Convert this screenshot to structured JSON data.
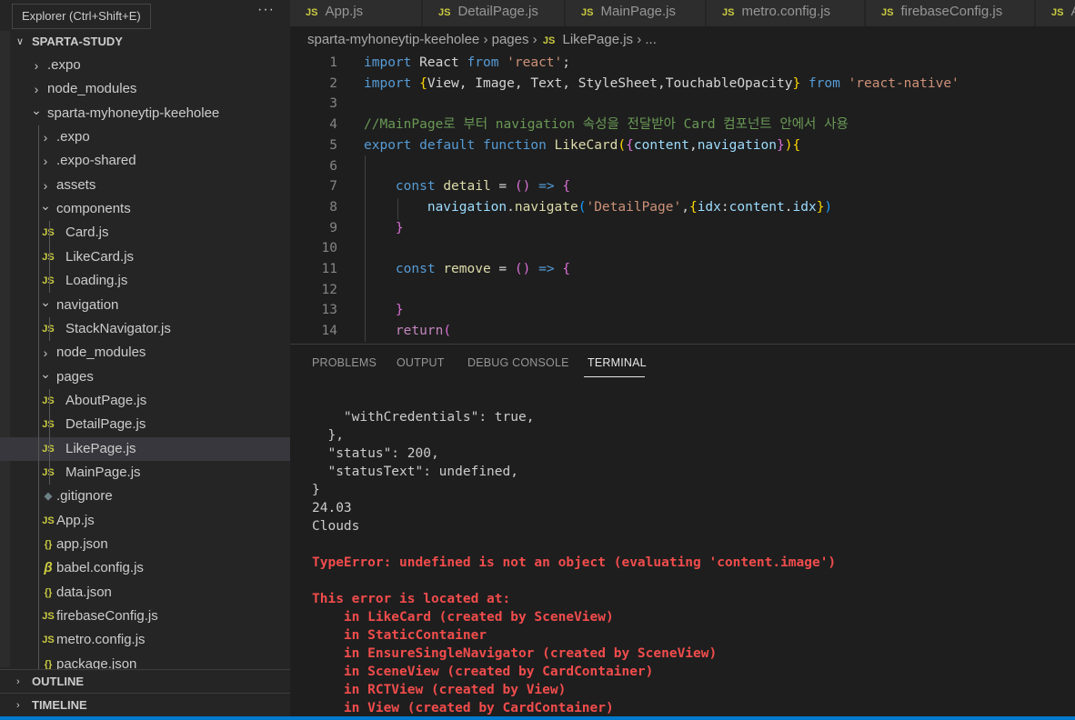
{
  "sidebar": {
    "tooltip": "Explorer (Ctrl+Shift+E)",
    "more_actions": "···",
    "root": "SPARTA-STUDY",
    "tree": [
      {
        "label": ".expo",
        "depth": 1,
        "kind": "folder",
        "expanded": false
      },
      {
        "label": "node_modules",
        "depth": 1,
        "kind": "folder",
        "expanded": false
      },
      {
        "label": "sparta-myhoneytip-keeholee",
        "depth": 1,
        "kind": "folder",
        "expanded": true
      },
      {
        "label": ".expo",
        "depth": 2,
        "kind": "folder",
        "expanded": false
      },
      {
        "label": ".expo-shared",
        "depth": 2,
        "kind": "folder",
        "expanded": false
      },
      {
        "label": "assets",
        "depth": 2,
        "kind": "folder",
        "expanded": false
      },
      {
        "label": "components",
        "depth": 2,
        "kind": "folder",
        "expanded": true
      },
      {
        "label": "Card.js",
        "depth": 3,
        "kind": "js"
      },
      {
        "label": "LikeCard.js",
        "depth": 3,
        "kind": "js"
      },
      {
        "label": "Loading.js",
        "depth": 3,
        "kind": "js"
      },
      {
        "label": "navigation",
        "depth": 2,
        "kind": "folder",
        "expanded": true
      },
      {
        "label": "StackNavigator.js",
        "depth": 3,
        "kind": "js"
      },
      {
        "label": "node_modules",
        "depth": 2,
        "kind": "folder",
        "expanded": false
      },
      {
        "label": "pages",
        "depth": 2,
        "kind": "folder",
        "expanded": true
      },
      {
        "label": "AboutPage.js",
        "depth": 3,
        "kind": "js"
      },
      {
        "label": "DetailPage.js",
        "depth": 3,
        "kind": "js"
      },
      {
        "label": "LikePage.js",
        "depth": 3,
        "kind": "js",
        "selected": true
      },
      {
        "label": "MainPage.js",
        "depth": 3,
        "kind": "js"
      },
      {
        "label": ".gitignore",
        "depth": 2,
        "kind": "git"
      },
      {
        "label": "App.js",
        "depth": 2,
        "kind": "js"
      },
      {
        "label": "app.json",
        "depth": 2,
        "kind": "json"
      },
      {
        "label": "babel.config.js",
        "depth": 2,
        "kind": "babel"
      },
      {
        "label": "data.json",
        "depth": 2,
        "kind": "json"
      },
      {
        "label": "firebaseConfig.js",
        "depth": 2,
        "kind": "js"
      },
      {
        "label": "metro.config.js",
        "depth": 2,
        "kind": "js"
      },
      {
        "label": "package.json",
        "depth": 2,
        "kind": "json"
      }
    ],
    "outline": "OUTLINE",
    "timeline": "TIMELINE"
  },
  "icons": {
    "js": "JS",
    "json": "{}",
    "git": "◆",
    "babel": "β",
    "chev_right": "›",
    "chev_down": "⌄"
  },
  "colors": {
    "js_icon": "#cbcb41",
    "json_icon": "#cbcb41",
    "git_icon": "#6d8086",
    "babel_icon": "#cbcb41",
    "error": "#f14c4c"
  },
  "editor": {
    "tabs": [
      "App.js",
      "DetailPage.js",
      "MainPage.js",
      "metro.config.js",
      "firebaseConfig.js",
      "A"
    ],
    "breadcrumb": {
      "project": "sparta-myhoneytip-keeholee",
      "sep": "›",
      "folder": "pages",
      "file": "LikePage.js",
      "more": "..."
    },
    "lines": [
      {
        "n": "1",
        "tokens": [
          [
            "kw",
            "import"
          ],
          [
            "plain",
            " React "
          ],
          [
            "kw",
            "from"
          ],
          [
            "plain",
            " "
          ],
          [
            "str",
            "'react'"
          ],
          [
            "plain",
            ";"
          ]
        ]
      },
      {
        "n": "2",
        "tokens": [
          [
            "kw",
            "import"
          ],
          [
            "plain",
            " "
          ],
          [
            "br1",
            "{"
          ],
          [
            "plain",
            "View, Image, Text, StyleSheet,TouchableOpacity"
          ],
          [
            "br1",
            "}"
          ],
          [
            "plain",
            " "
          ],
          [
            "kw",
            "from"
          ],
          [
            "plain",
            " "
          ],
          [
            "str",
            "'react-native'"
          ]
        ]
      },
      {
        "n": "3",
        "tokens": []
      },
      {
        "n": "4",
        "tokens": [
          [
            "cm",
            "//MainPage로 부터 navigation 속성을 전달받아 Card 컴포넌트 안에서 사용"
          ]
        ]
      },
      {
        "n": "5",
        "tokens": [
          [
            "kw",
            "export"
          ],
          [
            "plain",
            " "
          ],
          [
            "kw",
            "default"
          ],
          [
            "plain",
            " "
          ],
          [
            "kw",
            "function"
          ],
          [
            "plain",
            " "
          ],
          [
            "fn",
            "LikeCard"
          ],
          [
            "br1",
            "("
          ],
          [
            "br2",
            "{"
          ],
          [
            "var",
            "content"
          ],
          [
            "plain",
            ","
          ],
          [
            "var",
            "navigation"
          ],
          [
            "br2",
            "}"
          ],
          [
            "br1",
            ")"
          ],
          [
            "br1",
            "{"
          ]
        ]
      },
      {
        "n": "6",
        "tokens": []
      },
      {
        "n": "7",
        "tokens": [
          [
            "plain",
            "    "
          ],
          [
            "kw",
            "const"
          ],
          [
            "plain",
            " "
          ],
          [
            "fn",
            "detail"
          ],
          [
            "plain",
            " = "
          ],
          [
            "br2",
            "()"
          ],
          [
            "plain",
            " "
          ],
          [
            "kw",
            "=>"
          ],
          [
            "plain",
            " "
          ],
          [
            "br2",
            "{"
          ]
        ]
      },
      {
        "n": "8",
        "tokens": [
          [
            "plain",
            "        "
          ],
          [
            "var",
            "navigation"
          ],
          [
            "plain",
            "."
          ],
          [
            "fn",
            "navigate"
          ],
          [
            "br3",
            "("
          ],
          [
            "str",
            "'DetailPage'"
          ],
          [
            "plain",
            ","
          ],
          [
            "br1",
            "{"
          ],
          [
            "var",
            "idx"
          ],
          [
            "plain",
            ":"
          ],
          [
            "var",
            "content"
          ],
          [
            "plain",
            "."
          ],
          [
            "var",
            "idx"
          ],
          [
            "br1",
            "}"
          ],
          [
            "br3",
            ")"
          ]
        ]
      },
      {
        "n": "9",
        "tokens": [
          [
            "plain",
            "    "
          ],
          [
            "br2",
            "}"
          ]
        ]
      },
      {
        "n": "10",
        "tokens": []
      },
      {
        "n": "11",
        "tokens": [
          [
            "plain",
            "    "
          ],
          [
            "kw",
            "const"
          ],
          [
            "plain",
            " "
          ],
          [
            "fn",
            "remove"
          ],
          [
            "plain",
            " = "
          ],
          [
            "br2",
            "()"
          ],
          [
            "plain",
            " "
          ],
          [
            "kw",
            "=>"
          ],
          [
            "plain",
            " "
          ],
          [
            "br2",
            "{"
          ]
        ]
      },
      {
        "n": "12",
        "tokens": []
      },
      {
        "n": "13",
        "tokens": [
          [
            "plain",
            "    "
          ],
          [
            "br2",
            "}"
          ]
        ]
      },
      {
        "n": "14",
        "tokens": [
          [
            "plain",
            "    "
          ],
          [
            "ctl",
            "return"
          ],
          [
            "br2",
            "("
          ]
        ]
      }
    ]
  },
  "panel": {
    "tabs": [
      "PROBLEMS",
      "OUTPUT",
      "DEBUG CONSOLE",
      "TERMINAL"
    ],
    "active_tab": "TERMINAL",
    "terminal_lines": [
      {
        "text": "    \"withCredentials\": true,",
        "err": false
      },
      {
        "text": "  },",
        "err": false
      },
      {
        "text": "  \"status\": 200,",
        "err": false
      },
      {
        "text": "  \"statusText\": undefined,",
        "err": false
      },
      {
        "text": "}",
        "err": false
      },
      {
        "text": "24.03",
        "err": false
      },
      {
        "text": "Clouds",
        "err": false
      },
      {
        "text": "",
        "err": false
      },
      {
        "text": "TypeError: undefined is not an object (evaluating 'content.image')",
        "err": true
      },
      {
        "text": "",
        "err": false
      },
      {
        "text": "This error is located at:",
        "err": true
      },
      {
        "text": "    in LikeCard (created by SceneView)",
        "err": true
      },
      {
        "text": "    in StaticContainer",
        "err": true
      },
      {
        "text": "    in EnsureSingleNavigator (created by SceneView)",
        "err": true
      },
      {
        "text": "    in SceneView (created by CardContainer)",
        "err": true
      },
      {
        "text": "    in RCTView (created by View)",
        "err": true
      },
      {
        "text": "    in View (created by CardContainer)",
        "err": true
      }
    ]
  }
}
